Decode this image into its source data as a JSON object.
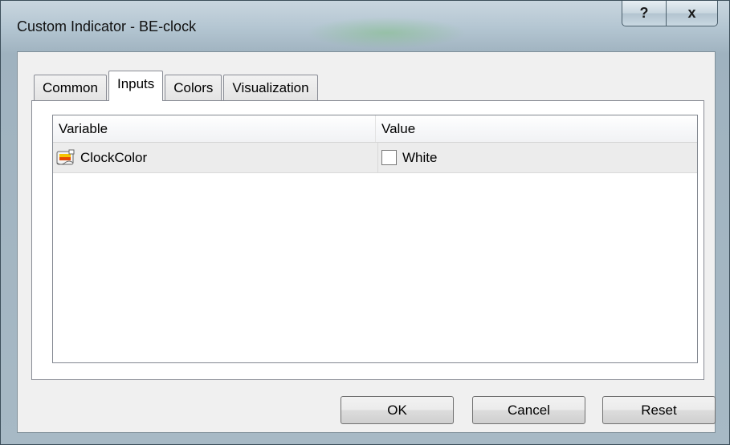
{
  "window": {
    "title": "Custom Indicator - BE-clock",
    "help_label": "?",
    "close_label": "x"
  },
  "tabs": [
    {
      "label": "Common",
      "active": false
    },
    {
      "label": "Inputs",
      "active": true
    },
    {
      "label": "Colors",
      "active": false
    },
    {
      "label": "Visualization",
      "active": false
    }
  ],
  "grid": {
    "columns": [
      "Variable",
      "Value"
    ],
    "rows": [
      {
        "variable": "ClockColor",
        "value": "White",
        "icon": "color-parameter-icon",
        "swatch_color": "#ffffff"
      }
    ]
  },
  "buttons": {
    "ok": "OK",
    "cancel": "Cancel",
    "reset": "Reset"
  }
}
